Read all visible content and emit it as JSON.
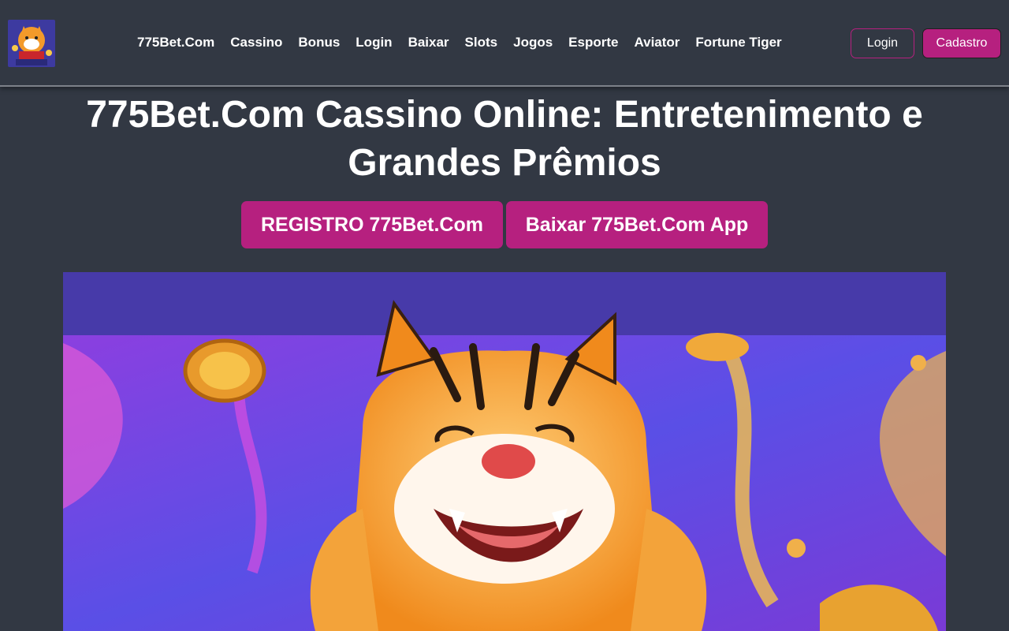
{
  "header": {
    "logo_text": "775Bet.Com",
    "nav": [
      "775Bet.Com",
      "Cassino",
      "Bonus",
      "Login",
      "Baixar",
      "Slots",
      "Jogos",
      "Esporte",
      "Aviator",
      "Fortune Tiger"
    ],
    "login_label": "Login",
    "signup_label": "Cadastro"
  },
  "main": {
    "title": "775Bet.Com Cassino Online: Entretenimento e Grandes Prêmios",
    "register_label": "REGISTRO 775Bet.Com",
    "download_label": "Baixar 775Bet.Com App"
  },
  "hero": {
    "icon": "tiger-mascot-image"
  },
  "colors": {
    "background": "#323843",
    "accent": "#b6207f",
    "banner_top": "#473aa9"
  }
}
